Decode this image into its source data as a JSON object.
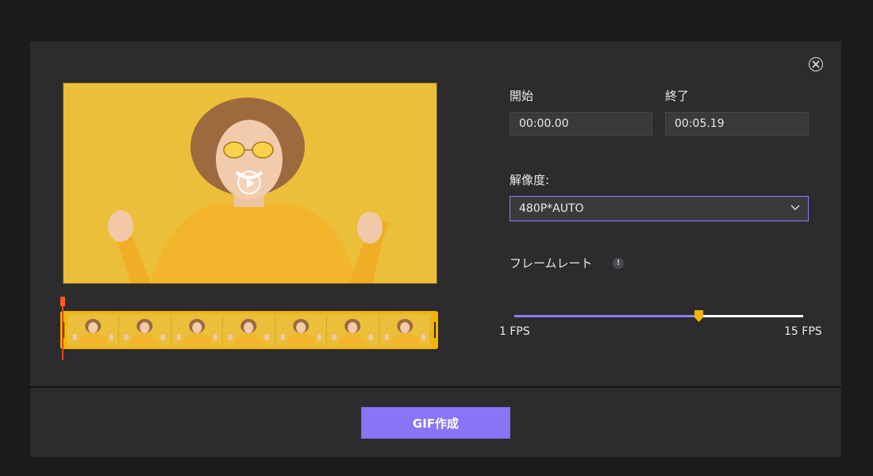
{
  "start": {
    "label": "開始",
    "value": "00:00.00"
  },
  "end": {
    "label": "終了",
    "value": "00:05.19"
  },
  "resolution": {
    "label": "解像度:",
    "selected": "480P*AUTO"
  },
  "frame_rate": {
    "label": "フレームレート",
    "info_icon_glyph": "!",
    "min_label": "1 FPS",
    "max_label": "15 FPS",
    "value_fraction": 0.64
  },
  "create_button": {
    "label": "GIF作成"
  },
  "icons": {
    "close": "close-circle-icon",
    "play": "play-icon",
    "dropdown": "chevron-down-icon",
    "info": "info-icon"
  },
  "colors": {
    "accent": "#8b74f5",
    "trim_handles": "#f5b400",
    "playhead": "#ff5a1f",
    "background": "#2c2c2e"
  },
  "filmstrip": {
    "frame_count": 7
  }
}
